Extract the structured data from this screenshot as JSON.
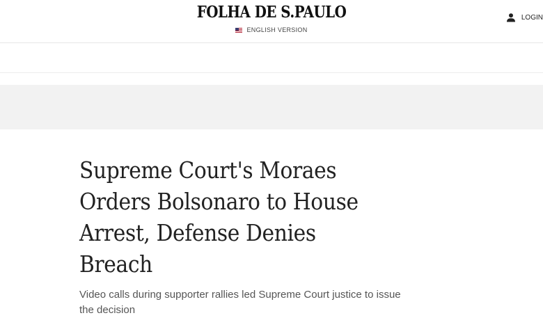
{
  "header": {
    "logo": "FOLHA DE S.PAULO",
    "edition_label": "ENGLISH VERSION",
    "edition_icon": "us-flag-icon",
    "login_label": "LOGIN",
    "login_icon": "user-icon"
  },
  "article": {
    "headline": "Supreme Court's Moraes Orders Bolsonaro to House Arrest, Defense Denies Breach",
    "subheadline": "Video calls during supporter rallies led Supreme Court justice to issue the decision"
  },
  "colors": {
    "text": "#222222",
    "subtext": "#555555",
    "ad_band": "#f2f2f2",
    "divider": "#e6e6e6"
  }
}
